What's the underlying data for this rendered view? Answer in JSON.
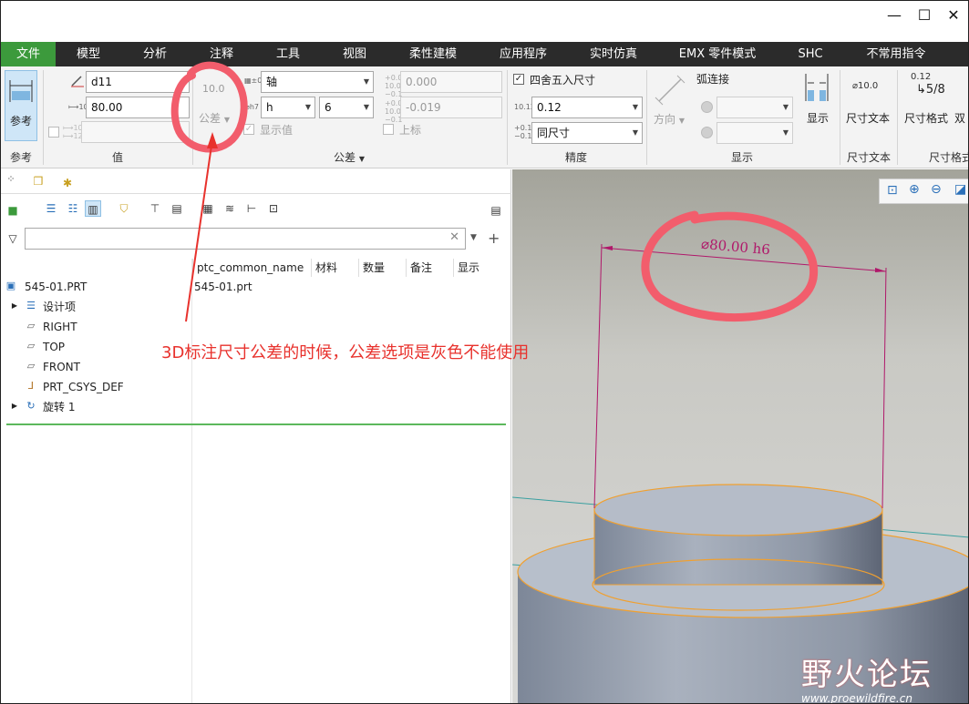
{
  "window": {
    "minimize": "—",
    "maximize": "☐",
    "close": "✕"
  },
  "menu": {
    "items": [
      "文件",
      "模型",
      "分析",
      "注释",
      "工具",
      "视图",
      "柔性建模",
      "应用程序",
      "实时仿真",
      "EMX 零件模式",
      "SHC",
      "不常用指令"
    ],
    "active_index": 0,
    "accent_color": "#3c9a3c"
  },
  "ribbon": {
    "reference": {
      "label": "参考",
      "group_label": "参考"
    },
    "value": {
      "name_value": "d11",
      "nominal_value": "80.00",
      "group_label": "值"
    },
    "tolerance": {
      "icon_text": "10.0",
      "button_label": "公差",
      "type_value": "轴",
      "fit_letter": "h",
      "fit_grade": "6",
      "show_value_label": "显示值",
      "upper_value": "0.000",
      "lower_value": "-0.019",
      "upper_label": "上标",
      "group_label": "公差"
    },
    "precision": {
      "round_label": "四舍五入尺寸",
      "precision_value": "0.12",
      "tolerance_precision_value": "同尺寸",
      "group_label": "精度"
    },
    "display": {
      "direction_label": "方向",
      "arc_connect_label": "弧连接",
      "show_label": "显示",
      "group_label": "显示"
    },
    "dim_text": {
      "icon_text": "⌀10.0",
      "label": "尺寸文本",
      "group_label": "尺寸文本"
    },
    "dim_format": {
      "icon_text": "0.12",
      "icon_frac": "5/8",
      "label": "尺寸格式",
      "dual_label": "双",
      "group_label": "尺寸格式"
    }
  },
  "model_tree": {
    "columns": [
      "ptc_common_name",
      "材料",
      "数量",
      "备注",
      "显示"
    ],
    "root": {
      "name": "545-01.PRT",
      "common_name": "545-01.prt"
    },
    "items": [
      {
        "name": "设计项",
        "expandable": true
      },
      {
        "name": "RIGHT",
        "expandable": false
      },
      {
        "name": "TOP",
        "expandable": false
      },
      {
        "name": "FRONT",
        "expandable": false
      },
      {
        "name": "PRT_CSYS_DEF",
        "expandable": false
      },
      {
        "name": "旋转 1",
        "expandable": true
      }
    ]
  },
  "viewport": {
    "dimension_text": "⌀80.00 h6",
    "dimension_color": "#b0186a"
  },
  "annotation": {
    "text": "3D标注尺寸公差的时候，公差选项是灰色不能使用",
    "color": "#e8322d"
  },
  "watermark": {
    "brand": "野火论坛",
    "url": "www.proewildfire.cn"
  }
}
